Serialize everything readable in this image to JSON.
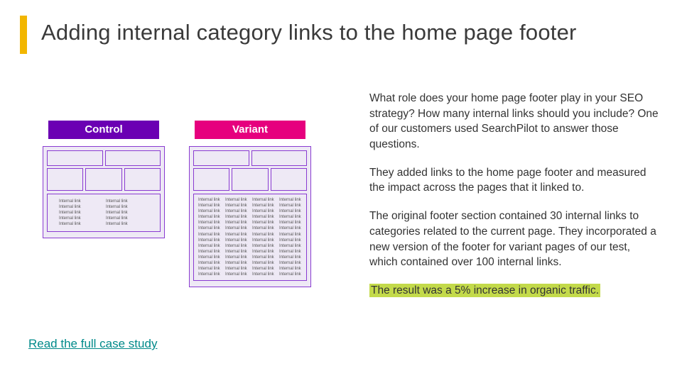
{
  "title": "Adding internal category links to the home page footer",
  "mockups": {
    "control_label": "Control",
    "variant_label": "Variant",
    "link_text": "Internal link"
  },
  "case_study_link": "Read the full case study",
  "paragraphs": {
    "p1": "What role does your home page footer play in your SEO strategy? How many internal links should you include? One of our customers used SearchPilot to answer those questions.",
    "p2": "They added links to the home page footer and measured the impact across the pages that it linked to.",
    "p3": "The original footer section contained 30 internal links to categories related to the current page. They incorporated a new version of the footer for variant pages of our test, which contained over 100 internal links.",
    "p4_highlight": "The result was a 5% increase in organic traffic."
  },
  "colors": {
    "accent": "#f2b600",
    "control": "#6b00b3",
    "variant": "#e6007e",
    "mock_border": "#8a3bd1",
    "link": "#008a8a",
    "highlight": "#c3da4a"
  }
}
